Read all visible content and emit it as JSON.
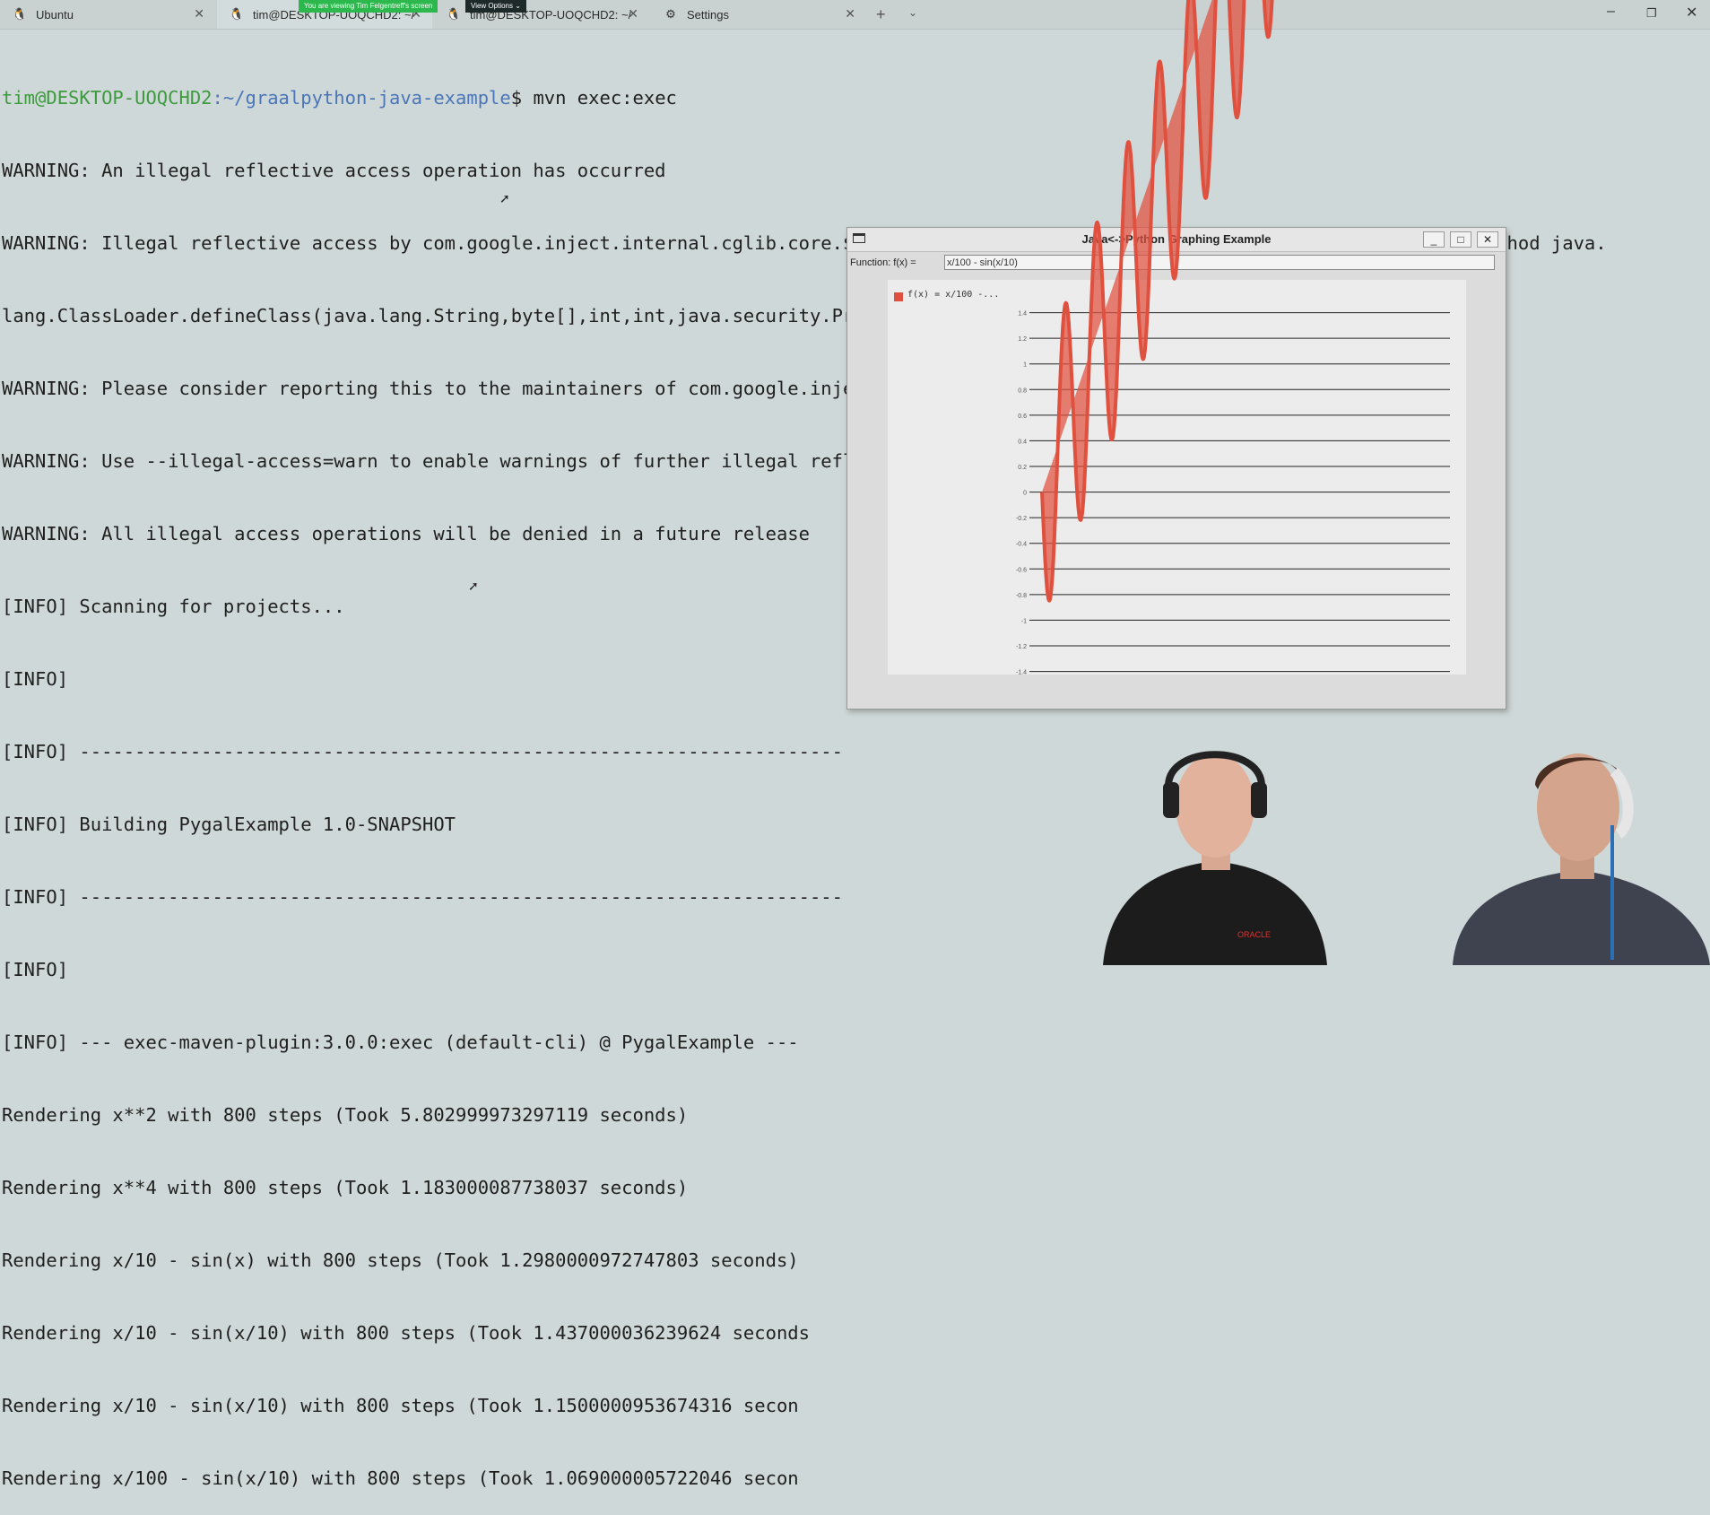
{
  "tabs": [
    {
      "label": "Ubuntu",
      "icon": "linux-tux-icon"
    },
    {
      "label": "tim@DESKTOP-UOQCHD2: ~/",
      "icon": "linux-tux-icon"
    },
    {
      "label": "tim@DESKTOP-UOQCHD2: ~/",
      "icon": "linux-tux-icon"
    },
    {
      "label": "Settings",
      "icon": "gear-icon"
    }
  ],
  "screen_share": {
    "banner": "You are viewing Tim Felgentreff's screen",
    "view_options": "View Options ⌄"
  },
  "terminal": {
    "prompt_user": "tim@DESKTOP-UOQCHD2",
    "prompt_path": ":~/graalpython-java-example",
    "prompt_sym": "$ ",
    "command": "mvn exec:exec",
    "lines": [
      "WARNING: An illegal reflective access operation has occurred",
      "WARNING: Illegal reflective access by com.google.inject.internal.cglib.core.$ReflectUtils$1 (file:/usr/share/maven/lib/guice.jar) to method java.",
      "lang.ClassLoader.defineClass(java.lang.String,byte[],int,int,java.security.ProtectionDomain)",
      "WARNING: Please consider reporting this to the maintainers of com.google.inject.internal.cglib.core.$ReflectUtils$1",
      "WARNING: Use --illegal-access=warn to enable warnings of further illegal reflective access operations",
      "WARNING: All illegal access operations will be denied in a future release",
      "[INFO] Scanning for projects...",
      "[INFO]",
      "[INFO] -----------------------------------------------------------------------",
      "[INFO] Building PygalExample 1.0-SNAPSHOT",
      "[INFO] -----------------------------------------------------------------------",
      "[INFO]",
      "[INFO] --- exec-maven-plugin:3.0.0:exec (default-cli) @ PygalExample ---",
      "Rendering x**2 with 800 steps (Took 5.802999973297119 seconds)",
      "Rendering x**4 with 800 steps (Took 1.183000087738037 seconds)",
      "Rendering x/10 - sin(x) with 800 steps (Took 1.2980000972747803 seconds)",
      "Rendering x/10 - sin(x/10) with 800 steps (Took 1.437000036239624 seconds",
      "Rendering x/10 - sin(x/10) with 800 steps (Took 1.1500000953674316 secon",
      "Rendering x/100 - sin(x/10) with 800 steps (Took 1.069000005722046 secon"
    ]
  },
  "plot_window": {
    "title": "Java<->Python Graphing Example",
    "minimize": "_",
    "maximize": "□",
    "close": "✕",
    "function_label": "Function: f(x) =",
    "function_value": "x/100 - sin(x/10)",
    "legend": "f(x) = x/100 -..."
  },
  "chart_data": {
    "type": "area",
    "title": "",
    "series": [
      {
        "name": "f(x) = x/100 -...",
        "expression": "x/100 - sin(x/10)",
        "x_range": [
          0,
          800
        ]
      }
    ],
    "y_ticks": [
      1.4,
      1.2,
      1,
      0.8,
      0.6,
      0.4,
      0.2,
      0,
      -0.2,
      -0.4,
      -0.6,
      -0.8,
      -1,
      -1.2,
      -1.4
    ],
    "ylim": [
      -1.55,
      1.6
    ],
    "color": "#e0503e",
    "grid": true,
    "legend_position": "top-left"
  }
}
